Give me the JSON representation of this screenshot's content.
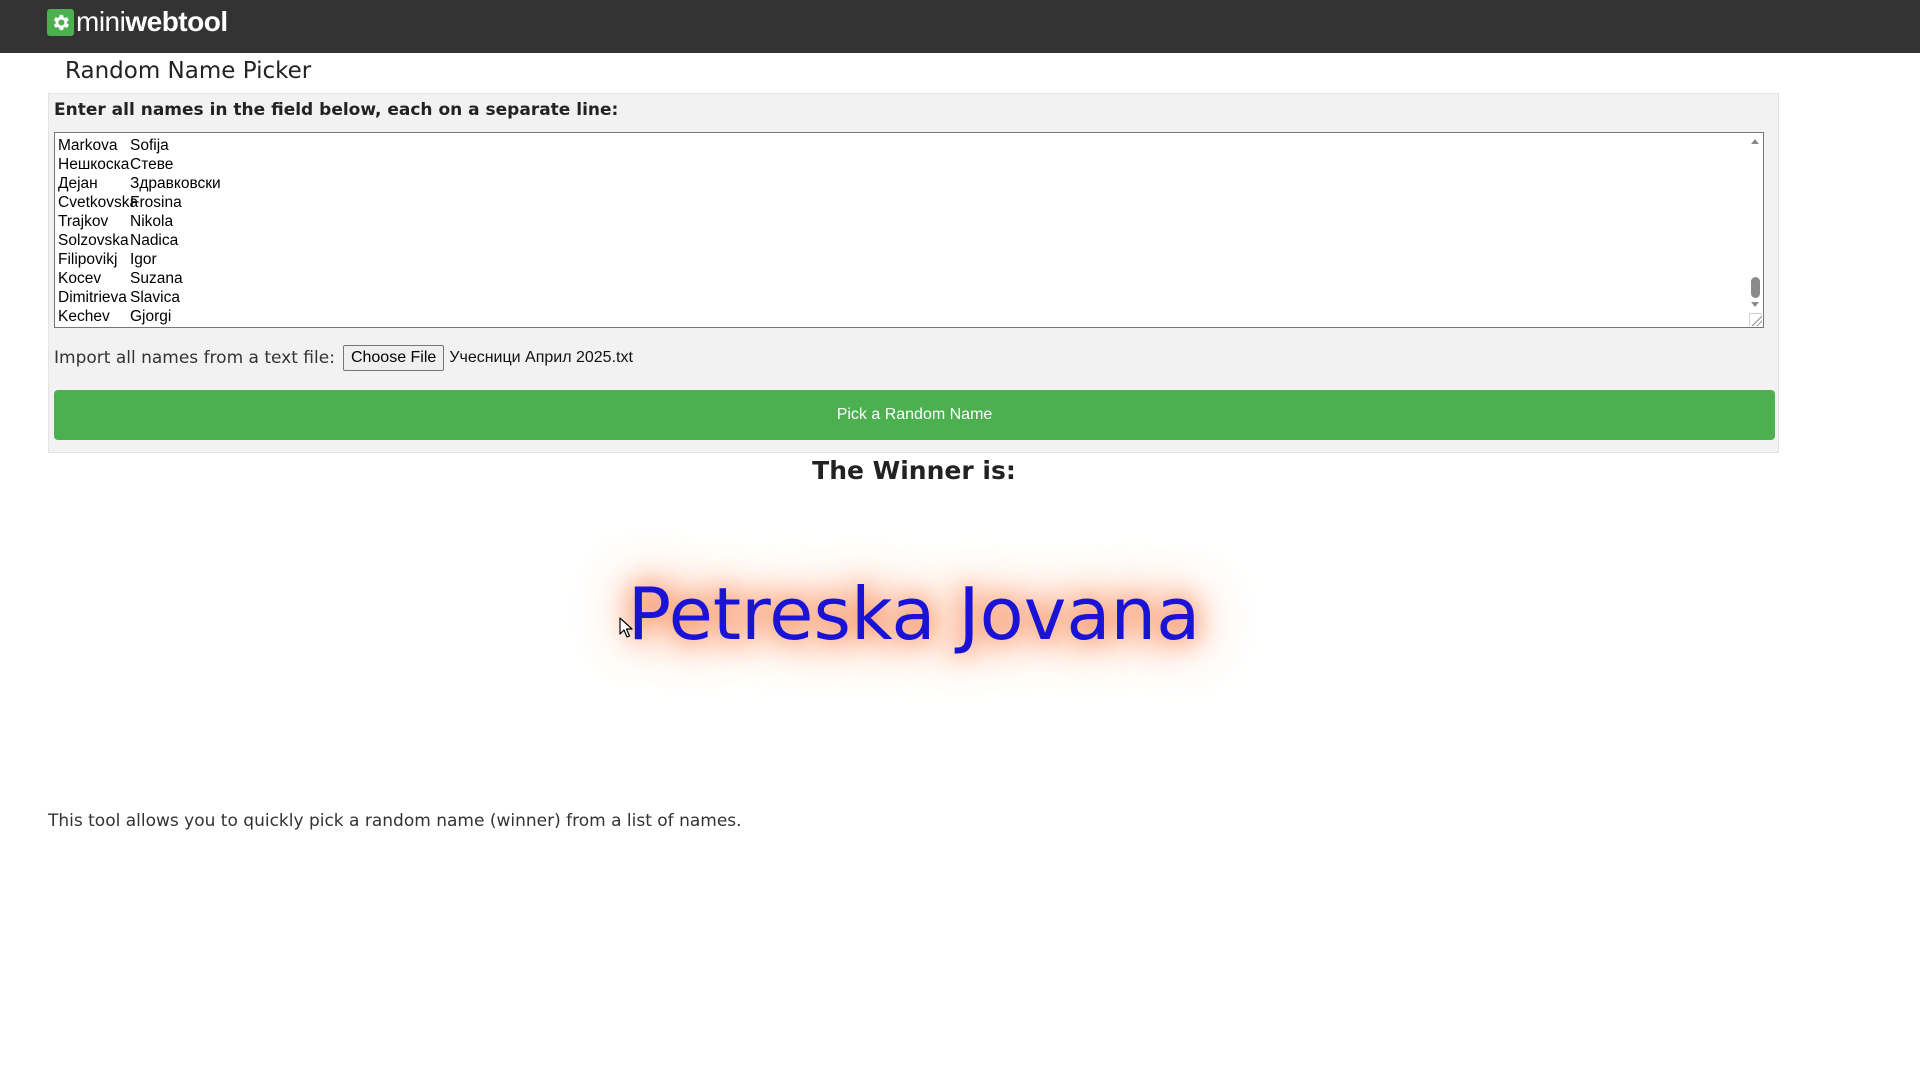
{
  "header": {
    "logo_text_light": "mini",
    "logo_text_bold": "webtool",
    "logo_icon": "gear-icon"
  },
  "page_title": "Random Name Picker",
  "form": {
    "label": "Enter all names in the field below, each on a separate line:",
    "names": [
      {
        "last": "Markova",
        "first": "Sofija"
      },
      {
        "last": "Нешкоска",
        "first": "Стеве"
      },
      {
        "last": "Дејан",
        "first": "Здравковски"
      },
      {
        "last": "Cvetkovska",
        "first": "Frosina"
      },
      {
        "last": "Trajkov",
        "first": "Nikola"
      },
      {
        "last": "Solzovska",
        "first": "Nadica"
      },
      {
        "last": "Filipovikj",
        "first": "Igor"
      },
      {
        "last": "Kocev",
        "first": "Suzana"
      },
      {
        "last": "Dimitrieva",
        "first": "Slavica"
      },
      {
        "last": "Kechev",
        "first": "Gjorgi"
      }
    ],
    "import_label": "Import all names from a text file:",
    "choose_file_label": "Choose File",
    "chosen_file_name": "Учесници Април 2025.txt",
    "pick_button_label": "Pick a Random Name"
  },
  "result": {
    "heading": "The Winner is:",
    "winner_name": "Petreska Jovana"
  },
  "description": "This tool allows you to quickly pick a random name (winner) from a list of names.",
  "colors": {
    "topbar": "#333333",
    "accent_green": "#4caf50",
    "winner_text": "#1a13d6",
    "winner_glow": "#f26a2e"
  }
}
